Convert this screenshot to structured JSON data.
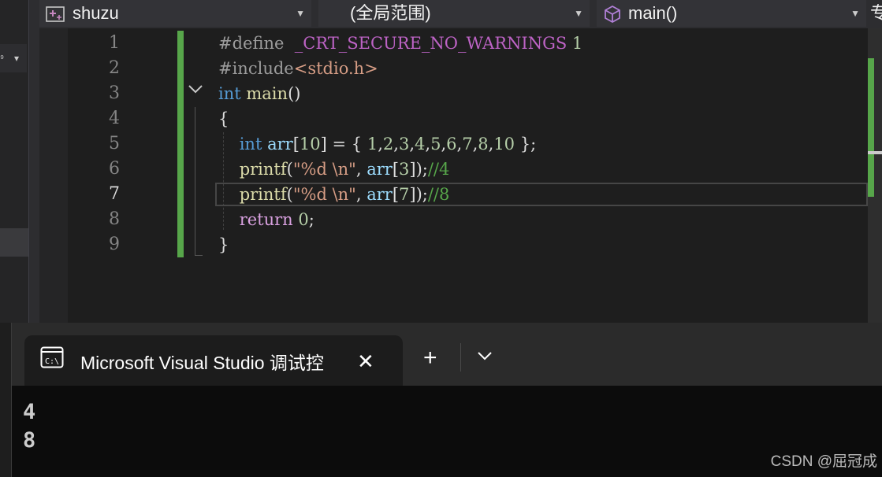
{
  "navbar": {
    "project": "shuzu",
    "scope": "(全局范围)",
    "member": "main()",
    "extra_char": "专",
    "icons": {
      "project": "project-class-icon",
      "member": "cube-method-icon"
    }
  },
  "editor": {
    "line_numbers": [
      "1",
      "2",
      "3",
      "4",
      "5",
      "6",
      "7",
      "8",
      "9"
    ],
    "current_line": "7",
    "lines": [
      [
        {
          "t": "#define  ",
          "c": "pp"
        },
        {
          "t": "_CRT_SECURE_NO_WARNINGS",
          "c": "mac"
        },
        {
          "t": " 1",
          "c": "num"
        }
      ],
      [
        {
          "t": "#include",
          "c": "pp"
        },
        {
          "t": "<stdio.h>",
          "c": "inc"
        }
      ],
      [
        {
          "t": "int",
          "c": "kw"
        },
        {
          "t": " ",
          "c": ""
        },
        {
          "t": "main",
          "c": "fn"
        },
        {
          "t": "()",
          "c": ""
        }
      ],
      [
        {
          "t": "{",
          "c": ""
        }
      ],
      [
        {
          "t": "    ",
          "c": ""
        },
        {
          "t": "int",
          "c": "kw"
        },
        {
          "t": " ",
          "c": ""
        },
        {
          "t": "arr",
          "c": "var"
        },
        {
          "t": "[",
          "c": ""
        },
        {
          "t": "10",
          "c": "num"
        },
        {
          "t": "] = { ",
          "c": ""
        },
        {
          "t": "1",
          "c": "num"
        },
        {
          "t": ",",
          "c": ""
        },
        {
          "t": "2",
          "c": "num"
        },
        {
          "t": ",",
          "c": ""
        },
        {
          "t": "3",
          "c": "num"
        },
        {
          "t": ",",
          "c": ""
        },
        {
          "t": "4",
          "c": "num"
        },
        {
          "t": ",",
          "c": ""
        },
        {
          "t": "5",
          "c": "num"
        },
        {
          "t": ",",
          "c": ""
        },
        {
          "t": "6",
          "c": "num"
        },
        {
          "t": ",",
          "c": ""
        },
        {
          "t": "7",
          "c": "num"
        },
        {
          "t": ",",
          "c": ""
        },
        {
          "t": "8",
          "c": "num"
        },
        {
          "t": ",",
          "c": ""
        },
        {
          "t": "10",
          "c": "num"
        },
        {
          "t": " };",
          "c": ""
        }
      ],
      [
        {
          "t": "    ",
          "c": ""
        },
        {
          "t": "printf",
          "c": "fn"
        },
        {
          "t": "(",
          "c": ""
        },
        {
          "t": "\"%d \\n\"",
          "c": "str"
        },
        {
          "t": ", ",
          "c": ""
        },
        {
          "t": "arr",
          "c": "var"
        },
        {
          "t": "[",
          "c": ""
        },
        {
          "t": "3",
          "c": "num"
        },
        {
          "t": "]);",
          "c": ""
        },
        {
          "t": "//4",
          "c": "cm"
        }
      ],
      [
        {
          "t": "    ",
          "c": ""
        },
        {
          "t": "printf",
          "c": "fn"
        },
        {
          "t": "(",
          "c": ""
        },
        {
          "t": "\"%d \\n\"",
          "c": "str"
        },
        {
          "t": ", ",
          "c": ""
        },
        {
          "t": "arr",
          "c": "var"
        },
        {
          "t": "[",
          "c": ""
        },
        {
          "t": "7",
          "c": "num"
        },
        {
          "t": "]);",
          "c": ""
        },
        {
          "t": "//8",
          "c": "cm"
        }
      ],
      [
        {
          "t": "    ",
          "c": ""
        },
        {
          "t": "return",
          "c": "ctl"
        },
        {
          "t": " ",
          "c": ""
        },
        {
          "t": "0",
          "c": "num"
        },
        {
          "t": ";",
          "c": ""
        }
      ],
      [
        {
          "t": "}",
          "c": ""
        }
      ]
    ]
  },
  "terminal": {
    "tab_title": "Microsoft Visual Studio 调试控",
    "close_label": "✕",
    "new_tab_label": "+",
    "output": [
      "4",
      "8"
    ]
  },
  "watermark": "CSDN @屈冠成",
  "colors": {
    "change_bar": "#57a64a",
    "editor_bg": "#1e1e1e",
    "terminal_bg": "#0c0c0c"
  }
}
